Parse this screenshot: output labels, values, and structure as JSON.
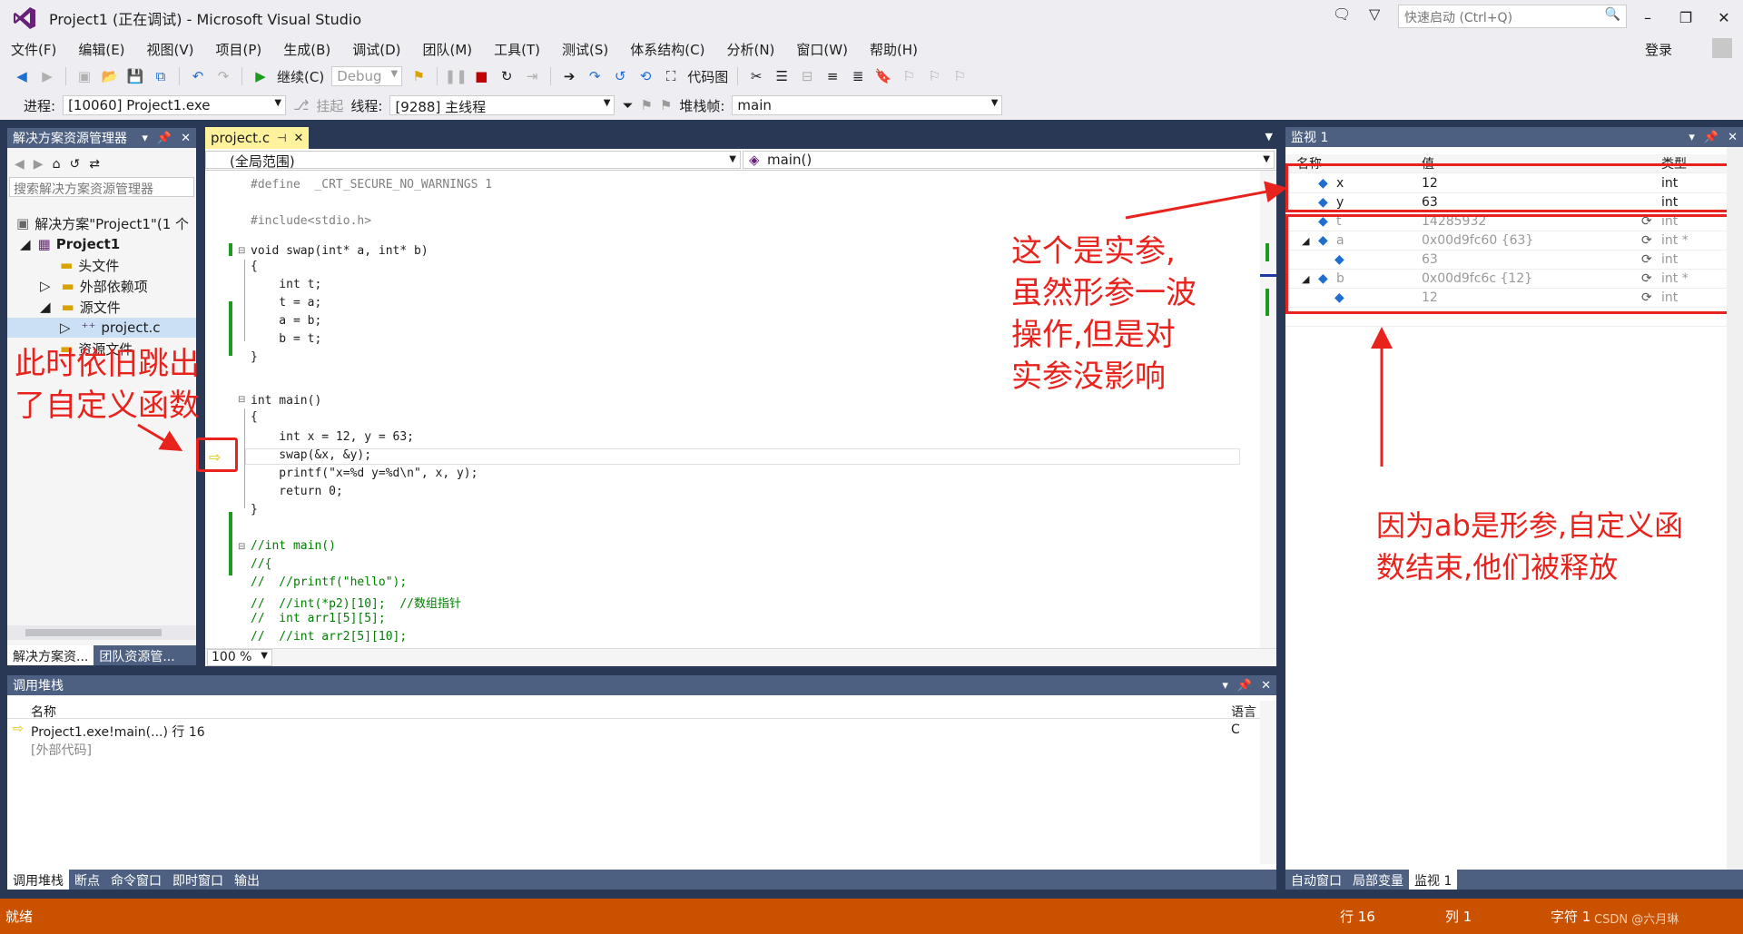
{
  "window": {
    "title": "Project1 (正在调试) - Microsoft Visual Studio",
    "quick_launch_placeholder": "快速启动 (Ctrl+Q)",
    "login": "登录"
  },
  "menu": [
    "文件(F)",
    "编辑(E)",
    "视图(V)",
    "项目(P)",
    "生成(B)",
    "调试(D)",
    "团队(M)",
    "工具(T)",
    "测试(S)",
    "体系结构(C)",
    "分析(N)",
    "窗口(W)",
    "帮助(H)"
  ],
  "toolbar": {
    "continue_label": "继续(C)",
    "config": "Debug",
    "codemap_label": "代码图"
  },
  "debug_bar": {
    "process_label": "进程:",
    "process_value": "[10060] Project1.exe",
    "suspend_label": "挂起",
    "thread_label": "线程:",
    "thread_value": "[9288] 主线程",
    "stackframe_label": "堆栈帧:",
    "stackframe_value": "main"
  },
  "solution_explorer": {
    "title": "解决方案资源管理器",
    "search_placeholder": "搜索解决方案资源管理器",
    "items": [
      "解决方案\"Project1\"(1 个",
      "Project1",
      "头文件",
      "外部依赖项",
      "源文件",
      "project.c",
      "资源文件"
    ],
    "bottom_tabs": [
      "解决方案资...",
      "团队资源管..."
    ]
  },
  "editor": {
    "tab": "project.c",
    "scope": "(全局范围)",
    "function": "main()",
    "zoom": "100 %",
    "lines": [
      "#define  _CRT_SECURE_NO_WARNINGS 1",
      "",
      "#include<stdio.h>",
      "",
      "void swap(int* a, int* b)",
      "{",
      "    int t;",
      "    t = a;",
      "    a = b;",
      "    b = t;",
      "}",
      "",
      "int main()",
      "{",
      "    int x = 12, y = 63;",
      "    swap(&x, &y);",
      "    printf(\"x=%d y=%d\\n\", x, y);",
      "    return 0;",
      "}",
      "",
      "//int main()",
      "//{",
      "//  //printf(\"hello\");",
      "//  //int(*p2)[10];  //数组指针",
      "//  int arr1[5][5];",
      "//  //int arr2[5][10];"
    ]
  },
  "watch": {
    "title": "监视 1",
    "columns": [
      "名称",
      "值",
      "类型"
    ],
    "rows": [
      {
        "name": "x",
        "value": "12",
        "type": "int"
      },
      {
        "name": "y",
        "value": "63",
        "type": "int"
      },
      {
        "name": "t",
        "value": "14285932",
        "type": "int"
      },
      {
        "name": "a",
        "value": "0x00d9fc60 {63}",
        "type": "int *"
      },
      {
        "name": "",
        "value": "63",
        "type": "int"
      },
      {
        "name": "b",
        "value": "0x00d9fc6c {12}",
        "type": "int *"
      },
      {
        "name": "",
        "value": "12",
        "type": "int"
      }
    ],
    "bottom_tabs": [
      "自动窗口",
      "局部变量",
      "监视 1"
    ]
  },
  "callstack": {
    "title": "调用堆栈",
    "columns": [
      "名称",
      "语言"
    ],
    "rows": [
      {
        "name": "Project1.exe!main(...) 行 16",
        "lang": "C"
      },
      {
        "name": "[外部代码]",
        "lang": ""
      }
    ],
    "bottom_tabs": [
      "调用堆栈",
      "断点",
      "命令窗口",
      "即时窗口",
      "输出"
    ]
  },
  "status": {
    "ready": "就绪",
    "line": "行 16",
    "col": "列 1",
    "char": "字符 1",
    "watermark": "CSDN @六月琳"
  },
  "annotations": {
    "left": [
      "此时依旧跳出",
      "了自定义函数"
    ],
    "middle": [
      "这个是实参,",
      "虽然形参一波",
      "操作,但是对",
      "实参没影响"
    ],
    "right": [
      "因为ab是形参,自定义函",
      "数结束,他们被释放"
    ]
  },
  "colors": {
    "accent_red": "#e8231e",
    "status_bar": "#ca5100",
    "vs_frame": "#293955"
  }
}
